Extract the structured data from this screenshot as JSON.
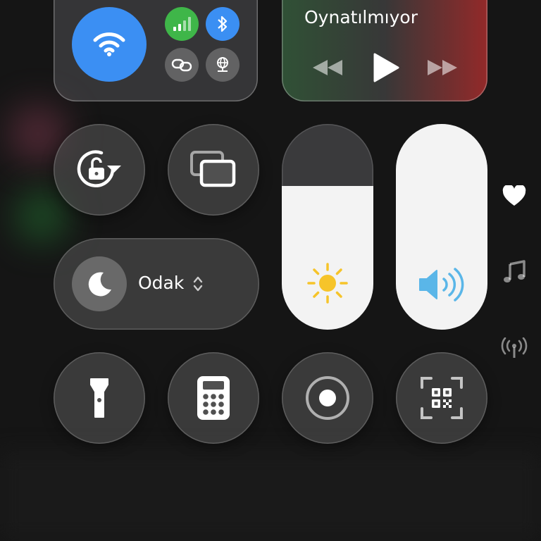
{
  "media": {
    "now_playing": "Oynatılmıyor",
    "controls": [
      "previous",
      "play",
      "next"
    ]
  },
  "connectivity": {
    "wifi": {
      "active": true,
      "color": "#3b8ff3"
    },
    "cellular": {
      "active": true,
      "color": "#3fb649"
    },
    "bluetooth": {
      "active": true,
      "color": "#3b8ff3"
    },
    "airdrop": {
      "active": false
    },
    "hotspot": {
      "active": false
    }
  },
  "focus": {
    "label": "Odak"
  },
  "sliders": {
    "brightness": {
      "level_percent": 70,
      "icon": "sun-icon",
      "icon_color": "#f6c42a"
    },
    "volume": {
      "level_percent": 100,
      "icon": "speaker-icon",
      "icon_color": "#5ab6e8"
    }
  },
  "controls": [
    "rotation-lock",
    "screen-mirroring",
    "flashlight",
    "calculator",
    "screen-record",
    "qr-scanner"
  ],
  "side_icons": [
    "heart-icon",
    "music-note-icon",
    "antenna-icon"
  ]
}
